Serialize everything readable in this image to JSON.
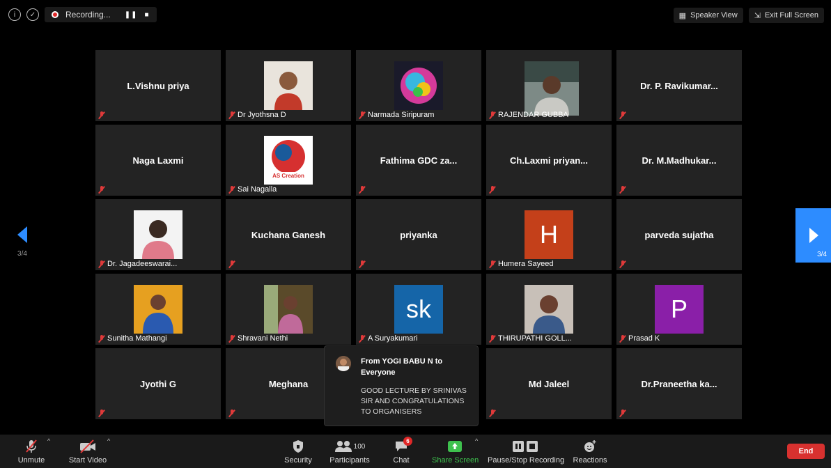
{
  "top_bar": {
    "recording_label": "Recording...",
    "speaker_view_label": "Speaker View",
    "exit_full_screen_label": "Exit Full Screen"
  },
  "page_indicator": "3/4",
  "tiles": [
    {
      "name": "L.Vishnu priya",
      "label": "",
      "kind": "name"
    },
    {
      "name": "",
      "label": "Dr Jyothsna D",
      "kind": "photo"
    },
    {
      "name": "",
      "label": "Narmada Siripuram",
      "kind": "photo"
    },
    {
      "name": "",
      "label": "RAJENDAR GUBBA",
      "kind": "photo"
    },
    {
      "name": "Dr. P. Ravikumar...",
      "label": "",
      "kind": "name"
    },
    {
      "name": "Naga Laxmi",
      "label": "",
      "kind": "name"
    },
    {
      "name": "",
      "label": "Sai Nagalla",
      "kind": "photo"
    },
    {
      "name": "Fathima GDC za...",
      "label": "",
      "kind": "name"
    },
    {
      "name": "Ch.Laxmi priyan...",
      "label": "",
      "kind": "name"
    },
    {
      "name": "Dr. M.Madhukar...",
      "label": "",
      "kind": "name"
    },
    {
      "name": "",
      "label": "Dr. Jagadeeswarai...",
      "kind": "photo"
    },
    {
      "name": "Kuchana Ganesh",
      "label": "",
      "kind": "name"
    },
    {
      "name": "priyanka",
      "label": "",
      "kind": "name"
    },
    {
      "name": "",
      "label": "Humera Sayeed",
      "kind": "letter",
      "letter": "H",
      "color": "#c4401a"
    },
    {
      "name": "parveda sujatha",
      "label": "",
      "kind": "name"
    },
    {
      "name": "",
      "label": "Sunitha Mathangi",
      "kind": "photo"
    },
    {
      "name": "",
      "label": "Shravani Nethi",
      "kind": "photo"
    },
    {
      "name": "",
      "label": "A Suryakumari",
      "kind": "letter",
      "letter": "sk",
      "color": "#1565a8"
    },
    {
      "name": "",
      "label": "THIRUPATHI GOLL...",
      "kind": "photo"
    },
    {
      "name": "",
      "label": "Prasad K",
      "kind": "letter",
      "letter": "P",
      "color": "#8a1fa8"
    },
    {
      "name": "Jyothi G",
      "label": "",
      "kind": "name"
    },
    {
      "name": "Meghana",
      "label": "",
      "kind": "name"
    },
    {
      "name": "",
      "label": "",
      "kind": "hidden"
    },
    {
      "name": "Md Jaleel",
      "label": "",
      "kind": "name"
    },
    {
      "name": "Dr.Praneetha ka...",
      "label": "",
      "kind": "name"
    }
  ],
  "chat_popup": {
    "from": "From YOGI BABU N to Everyone",
    "message": "GOOD LECTURE BY SRINIVAS SIR AND CONGRATULATIONS TO ORGANISERS"
  },
  "toolbar": {
    "unmute": "Unmute",
    "start_video": "Start Video",
    "security": "Security",
    "participants": "Participants",
    "participants_count": "100",
    "chat": "Chat",
    "chat_badge": "6",
    "share_screen": "Share Screen",
    "pause_stop_recording": "Pause/Stop Recording",
    "reactions": "Reactions",
    "end": "End"
  },
  "colors": {
    "accent_blue": "#2d8cff",
    "end_red": "#d8312f",
    "share_green": "#3ec14e"
  }
}
